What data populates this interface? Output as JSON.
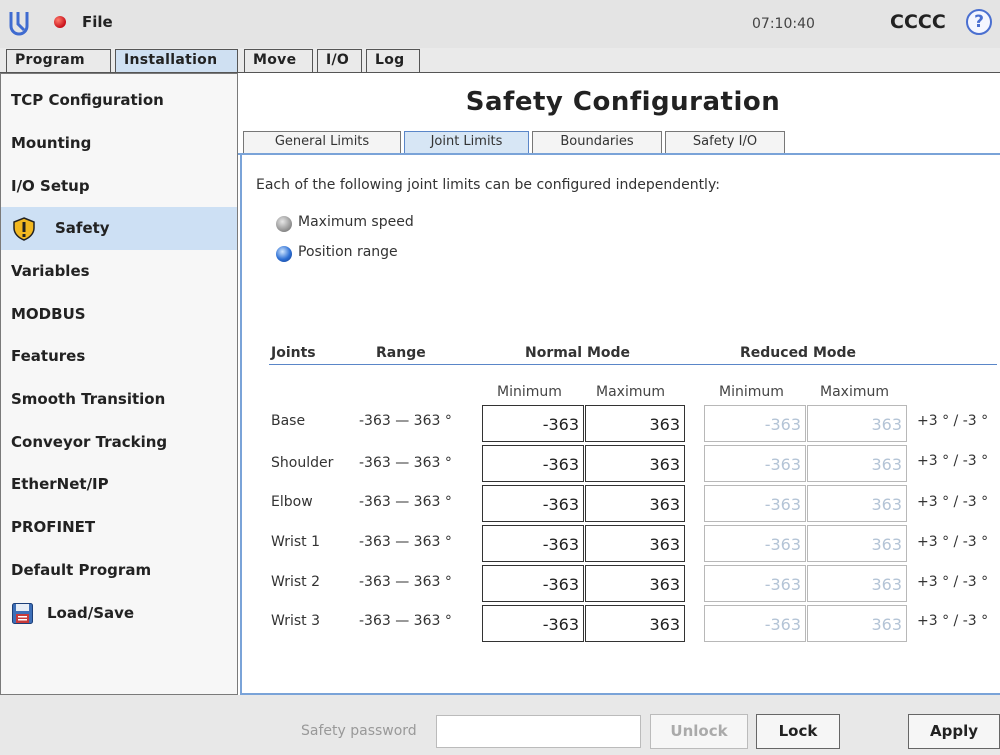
{
  "topbar": {
    "file_label": "File",
    "clock": "07:10:40",
    "robot_name": "CCCC",
    "help_glyph": "?"
  },
  "main_tabs": [
    "Program",
    "Installation",
    "Move",
    "I/O",
    "Log"
  ],
  "sidebar": {
    "items": [
      {
        "label": "TCP Configuration"
      },
      {
        "label": "Mounting"
      },
      {
        "label": "I/O Setup"
      },
      {
        "label": "Safety",
        "icon": "warning-shield-icon",
        "active": true
      },
      {
        "label": "Variables"
      },
      {
        "label": "MODBUS"
      },
      {
        "label": "Features"
      },
      {
        "label": "Smooth Transition"
      },
      {
        "label": "Conveyor Tracking"
      },
      {
        "label": "EtherNet/IP"
      },
      {
        "label": "PROFINET"
      },
      {
        "label": "Default Program"
      },
      {
        "label": "Load/Save",
        "icon": "floppy-disk-icon"
      }
    ]
  },
  "content": {
    "title": "Safety Configuration",
    "sub_tabs": [
      "General Limits",
      "Joint Limits",
      "Boundaries",
      "Safety I/O"
    ],
    "active_sub_tab": "Joint Limits",
    "description": "Each of the following joint limits can be configured independently:",
    "options": [
      {
        "label": "Maximum speed",
        "selected": false
      },
      {
        "label": "Position range",
        "selected": true
      }
    ],
    "table": {
      "headers": {
        "joints": "Joints",
        "range": "Range",
        "normal": "Normal Mode",
        "reduced": "Reduced Mode"
      },
      "subheaders": {
        "normal_min": "Minimum",
        "normal_max": "Maximum",
        "reduced_min": "Minimum",
        "reduced_max": "Maximum"
      },
      "rows": [
        {
          "joint": "Base",
          "range": "-363 — 363 °",
          "normal_min": "-363",
          "normal_max": "363",
          "reduced_min": "-363",
          "reduced_max": "363",
          "tolerance": "+3 ° / -3 °"
        },
        {
          "joint": "Shoulder",
          "range": "-363 — 363 °",
          "normal_min": "-363",
          "normal_max": "363",
          "reduced_min": "-363",
          "reduced_max": "363",
          "tolerance": "+3 ° / -3 °"
        },
        {
          "joint": "Elbow",
          "range": "-363 — 363 °",
          "normal_min": "-363",
          "normal_max": "363",
          "reduced_min": "-363",
          "reduced_max": "363",
          "tolerance": "+3 ° / -3 °"
        },
        {
          "joint": "Wrist 1",
          "range": "-363 — 363 °",
          "normal_min": "-363",
          "normal_max": "363",
          "reduced_min": "-363",
          "reduced_max": "363",
          "tolerance": "+3 ° / -3 °"
        },
        {
          "joint": "Wrist 2",
          "range": "-363 — 363 °",
          "normal_min": "-363",
          "normal_max": "363",
          "reduced_min": "-363",
          "reduced_max": "363",
          "tolerance": "+3 ° / -3 °"
        },
        {
          "joint": "Wrist 3",
          "range": "-363 — 363 °",
          "normal_min": "-363",
          "normal_max": "363",
          "reduced_min": "-363",
          "reduced_max": "363",
          "tolerance": "+3 ° / -3 °"
        }
      ]
    }
  },
  "bottombar": {
    "password_label": "Safety password",
    "password_value": "",
    "unlock_label": "Unlock",
    "lock_label": "Lock",
    "apply_label": "Apply"
  },
  "colors": {
    "selected_tab": "#cfe0f2",
    "accent_blue": "#7aa3d8",
    "record_red": "#c8101a"
  }
}
